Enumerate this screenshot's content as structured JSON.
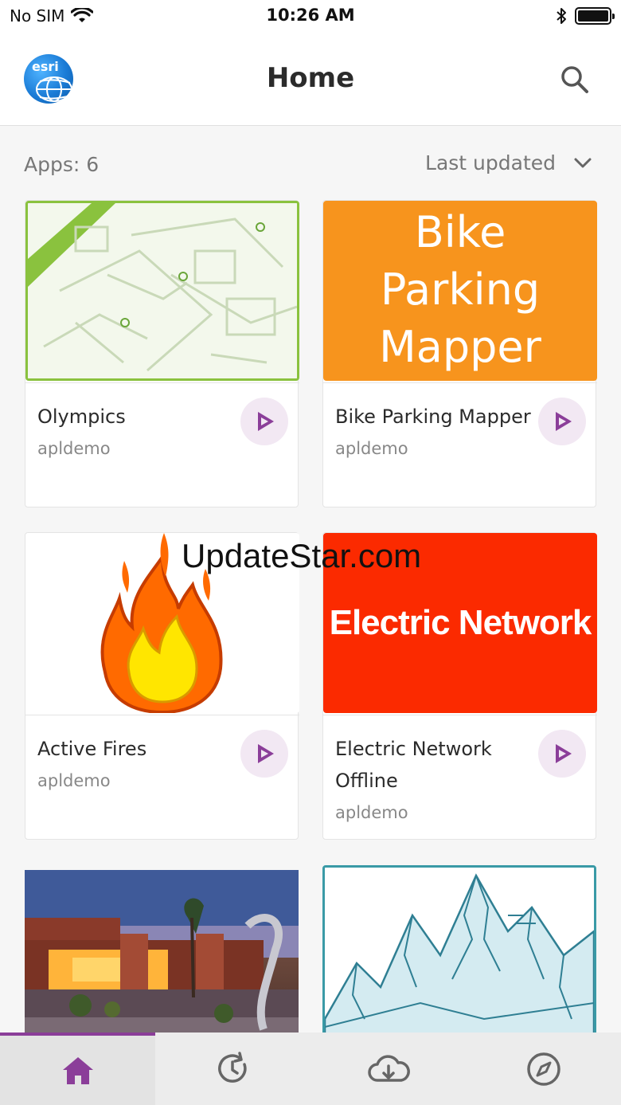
{
  "status_bar": {
    "carrier": "No SIM",
    "time": "10:26 AM"
  },
  "header": {
    "title": "Home",
    "logo_text": "esri"
  },
  "sort_bar": {
    "count_label": "Apps: 6",
    "sort_label": "Last updated"
  },
  "apps": [
    {
      "title": "Olympics",
      "owner": "apldemo"
    },
    {
      "title": "Bike Parking Mapper",
      "owner": "apldemo",
      "thumb_lines": [
        "Bike",
        "Parking",
        "Mapper"
      ]
    },
    {
      "title": "Active Fires",
      "owner": "apldemo"
    },
    {
      "title": "Electric Network Offline",
      "owner": "apldemo",
      "thumb_text": "Electric Network"
    }
  ],
  "watermark": "UpdateStar.com",
  "tabs": [
    {
      "name": "home",
      "icon": "home-icon",
      "active": true
    },
    {
      "name": "recent",
      "icon": "history-icon",
      "active": false
    },
    {
      "name": "downloads",
      "icon": "cloud-download-icon",
      "active": false
    },
    {
      "name": "explore",
      "icon": "compass-icon",
      "active": false
    }
  ],
  "colors": {
    "accent": "#8b3e99",
    "bike_orange": "#f7941d",
    "electric_red": "#fb2a00",
    "map_green": "#8ac23e",
    "mountain_teal": "#3a9aa6"
  }
}
